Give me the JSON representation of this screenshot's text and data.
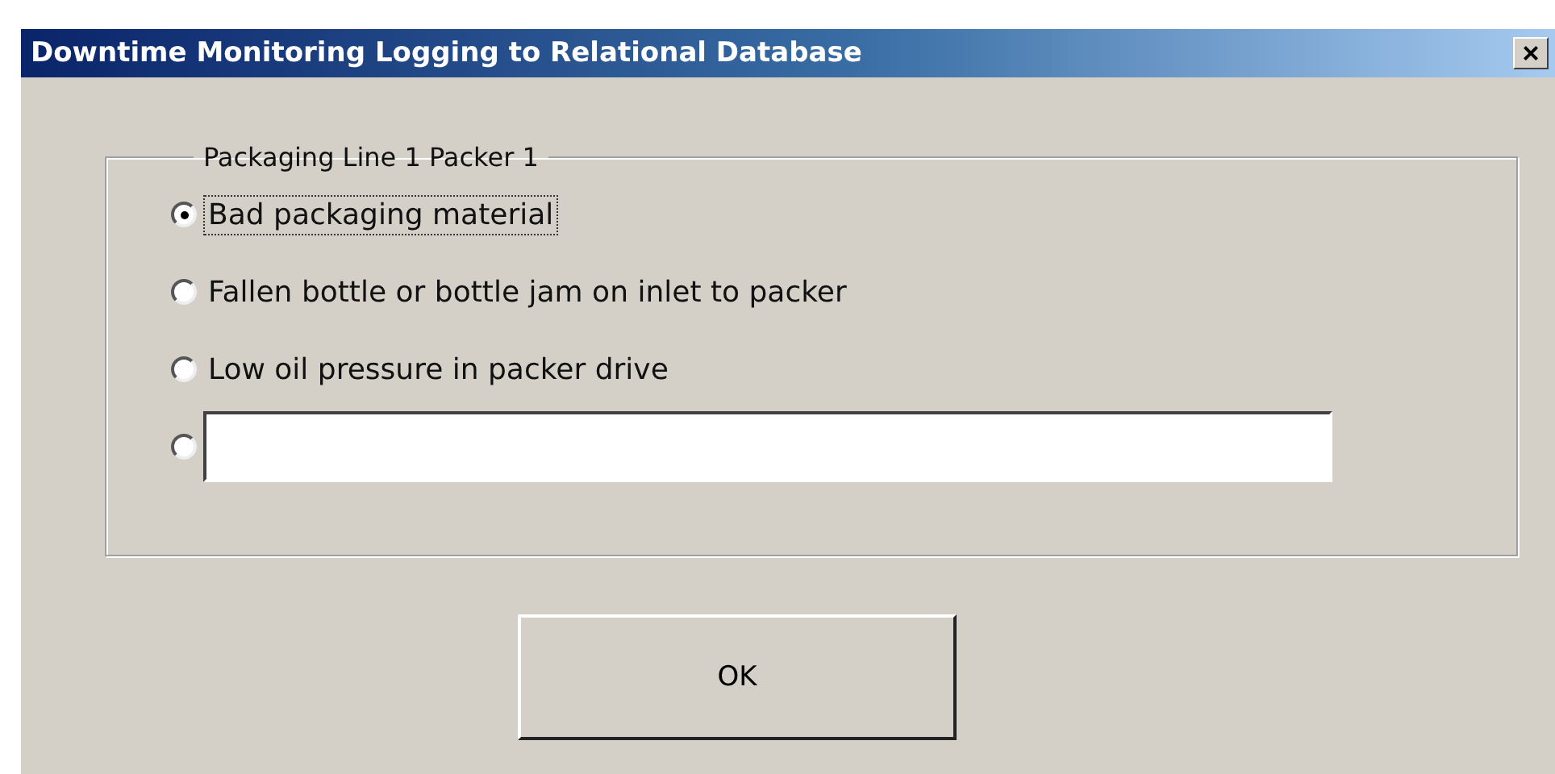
{
  "window": {
    "title": "Downtime Monitoring Logging to Relational Database",
    "close": "×"
  },
  "group": {
    "title": "Packaging Line 1 Packer 1",
    "options": [
      {
        "kind": "option",
        "label": "Bad packaging material",
        "selected": true
      },
      {
        "kind": "option",
        "label": "Fallen bottle or bottle jam on inlet to packer",
        "selected": false
      },
      {
        "kind": "option",
        "label": "Low oil pressure in packer drive",
        "selected": false
      },
      {
        "kind": "other",
        "selected": false
      }
    ]
  },
  "buttons": [
    "OK"
  ]
}
